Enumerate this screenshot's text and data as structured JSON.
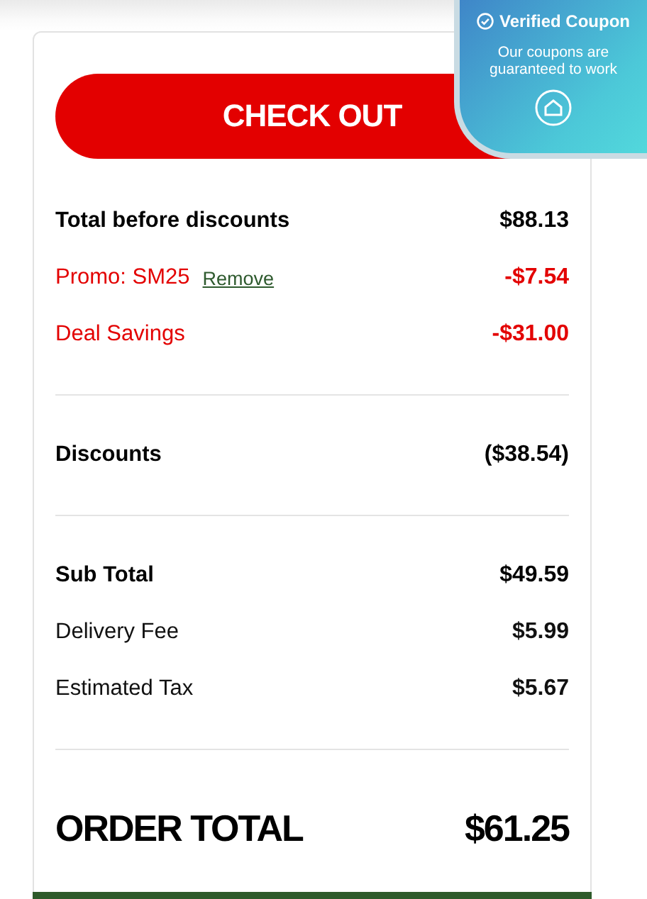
{
  "checkout_button": {
    "label": "CHECK OUT"
  },
  "sections": [
    [
      {
        "kind": "bold",
        "label": "Total before discounts",
        "value": "$88.13"
      },
      {
        "kind": "discount",
        "label": "Promo: SM25",
        "link": "Remove",
        "value": "-$7.54"
      },
      {
        "kind": "discount",
        "label": "Deal Savings",
        "value": "-$31.00"
      }
    ],
    [
      {
        "kind": "bold",
        "label": "Discounts",
        "value": "($38.54)"
      }
    ],
    [
      {
        "kind": "bold",
        "label": "Sub Total",
        "value": "$49.59"
      },
      {
        "kind": "plain",
        "label": "Delivery Fee",
        "value": "$5.99"
      },
      {
        "kind": "plain",
        "label": "Estimated Tax",
        "value": "$5.67"
      }
    ]
  ],
  "order_total": {
    "label": "ORDER TOTAL",
    "value": "$61.25"
  },
  "coupon_badge": {
    "title": "Verified Coupon",
    "text": "Our coupons are guaranteed to work"
  }
}
